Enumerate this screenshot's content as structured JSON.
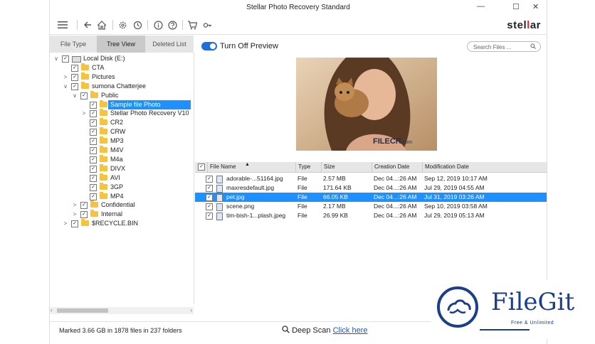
{
  "window": {
    "title": "Stellar Photo Recovery Standard",
    "controls": {
      "minimize": "—",
      "maximize": "☐",
      "close": "✕"
    }
  },
  "toolbar": {
    "icons": [
      "menu-icon",
      "back-icon",
      "home-icon",
      "settings-icon",
      "history-icon",
      "info-icon",
      "help-icon",
      "cart-icon",
      "key-icon"
    ],
    "logo_prefix": "stel",
    "logo_accent": "l",
    "logo_suffix": "ar"
  },
  "tabs": [
    {
      "label": "File Type",
      "active": false
    },
    {
      "label": "Tree View",
      "active": true
    },
    {
      "label": "Deleted List",
      "active": false
    }
  ],
  "tree": [
    {
      "label": "Local Disk (E:)",
      "level": 0,
      "expander": "∨",
      "folder": false
    },
    {
      "label": "CTA",
      "level": 1,
      "expander": "",
      "folder": true
    },
    {
      "label": "Pictures",
      "level": 1,
      "expander": ">",
      "folder": true
    },
    {
      "label": "sumona Chatterjee",
      "level": 1,
      "expander": "∨",
      "folder": true
    },
    {
      "label": "Public",
      "level": 2,
      "expander": "∨",
      "folder": true
    },
    {
      "label": "Sample file Photo",
      "level": 3,
      "expander": "",
      "folder": true,
      "selected": true
    },
    {
      "label": "Stellar Photo Recovery V10",
      "level": 3,
      "expander": ">",
      "folder": true
    },
    {
      "label": "CR2",
      "level": 3,
      "expander": "",
      "folder": true
    },
    {
      "label": "CRW",
      "level": 3,
      "expander": "",
      "folder": true
    },
    {
      "label": "MP3",
      "level": 3,
      "expander": "",
      "folder": true
    },
    {
      "label": "M4V",
      "level": 3,
      "expander": "",
      "folder": true
    },
    {
      "label": "M4a",
      "level": 3,
      "expander": "",
      "folder": true
    },
    {
      "label": "DIVX",
      "level": 3,
      "expander": "",
      "folder": true
    },
    {
      "label": "AVI",
      "level": 3,
      "expander": "",
      "folder": true
    },
    {
      "label": "3GP",
      "level": 3,
      "expander": "",
      "folder": true
    },
    {
      "label": "MP4",
      "level": 3,
      "expander": "",
      "folder": true
    },
    {
      "label": "Confidential",
      "level": 2,
      "expander": ">",
      "folder": true
    },
    {
      "label": "Internal",
      "level": 2,
      "expander": ">",
      "folder": true
    },
    {
      "label": "$RECYCLE.BIN",
      "level": 1,
      "expander": ">",
      "folder": true
    }
  ],
  "preview": {
    "toggle_label": "Turn Off Preview",
    "toggle_on": true,
    "search_placeholder": "Search Files ...",
    "photo_watermark": "FILECR",
    "photo_watermark_suffix": ".com"
  },
  "grid": {
    "columns": [
      "File Name",
      "Type",
      "Size",
      "Creation Date",
      "Modification Date"
    ],
    "rows": [
      {
        "name": "adorable-...51164.jpg",
        "type": "File",
        "size": "2.57 MB",
        "created": "Dec 04...:26 AM",
        "modified": "Sep 12, 2019 10:17 AM",
        "selected": false
      },
      {
        "name": "maxresdefault.jpg",
        "type": "File",
        "size": "171.64 KB",
        "created": "Dec 04...:26 AM",
        "modified": "Jul 29, 2019 04:55 AM",
        "selected": false
      },
      {
        "name": "pet.jpg",
        "type": "File",
        "size": "66.05 KB",
        "created": "Dec 04...:26 AM",
        "modified": "Jul 31, 2019 03:26 AM",
        "selected": true
      },
      {
        "name": "scene.png",
        "type": "File",
        "size": "2.17 MB",
        "created": "Dec 04...:26 AM",
        "modified": "Sep 10, 2019 03:58 AM",
        "selected": false
      },
      {
        "name": "tim-bish-1...plash.jpeg",
        "type": "File",
        "size": "26.99 KB",
        "created": "Dec 04...:26 AM",
        "modified": "Jul 29, 2019 05:13 AM",
        "selected": false
      }
    ]
  },
  "status": {
    "marked": "Marked 3.66 GB in 1878 files in 237 folders",
    "deep_scan_label": "Deep Scan",
    "deep_scan_link": "Click here"
  },
  "watermark": {
    "brand": "FileGit",
    "tagline": "Free & Unlimited"
  },
  "colors": {
    "accent": "#1e90ff",
    "toggle": "#1e6fd9",
    "logo_red": "#e3262e",
    "folder": "#f5c342",
    "watermark": "#1c3f8a"
  }
}
